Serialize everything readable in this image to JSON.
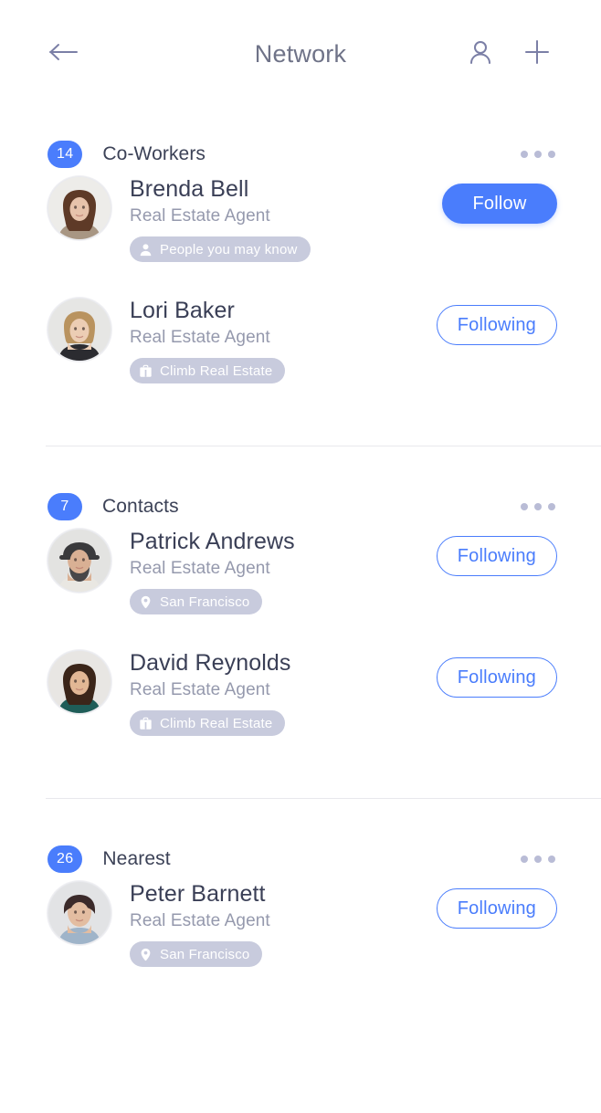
{
  "header": {
    "title": "Network",
    "back_icon": "arrow-left-icon",
    "person_icon": "person-outline-icon",
    "add_icon": "plus-icon"
  },
  "colors": {
    "accent_blue": "#4a7dfc",
    "badge_blue": "#4a7dfc",
    "pill_gray": "#c8cbdd",
    "title_gray": "#6f7388",
    "name_dark": "#3a3f56",
    "role_gray": "#9599ad",
    "divider": "#e8e8ec",
    "dots_gray": "#b9bcd6"
  },
  "labels": {
    "more_options": "more-options",
    "follow": "Follow",
    "following": "Following"
  },
  "sections": [
    {
      "count": "14",
      "title": "Co-Workers",
      "people": [
        {
          "name": "Brenda Bell",
          "role": "Real Estate Agent",
          "tag": "People you may know",
          "tag_icon": "person-icon",
          "action": "Follow",
          "action_state": "follow",
          "avatar": "brenda-bell-avatar"
        },
        {
          "name": "Lori Baker",
          "role": "Real Estate Agent",
          "tag": "Climb Real Estate",
          "tag_icon": "briefcase-icon",
          "action": "Following",
          "action_state": "following",
          "avatar": "lori-baker-avatar"
        }
      ]
    },
    {
      "count": "7",
      "title": "Contacts",
      "people": [
        {
          "name": "Patrick Andrews",
          "role": "Real Estate Agent",
          "tag": "San Francisco",
          "tag_icon": "location-pin-icon",
          "action": "Following",
          "action_state": "following",
          "avatar": "patrick-andrews-avatar"
        },
        {
          "name": "David Reynolds",
          "role": "Real Estate Agent",
          "tag": "Climb Real Estate",
          "tag_icon": "briefcase-icon",
          "action": "Following",
          "action_state": "following",
          "avatar": "david-reynolds-avatar"
        }
      ]
    },
    {
      "count": "26",
      "title": "Nearest",
      "people": [
        {
          "name": "Peter Barnett",
          "role": "Real Estate Agent",
          "tag": "San Francisco",
          "tag_icon": "location-pin-icon",
          "action": "Following",
          "action_state": "following",
          "avatar": "peter-barnett-avatar"
        }
      ]
    }
  ]
}
